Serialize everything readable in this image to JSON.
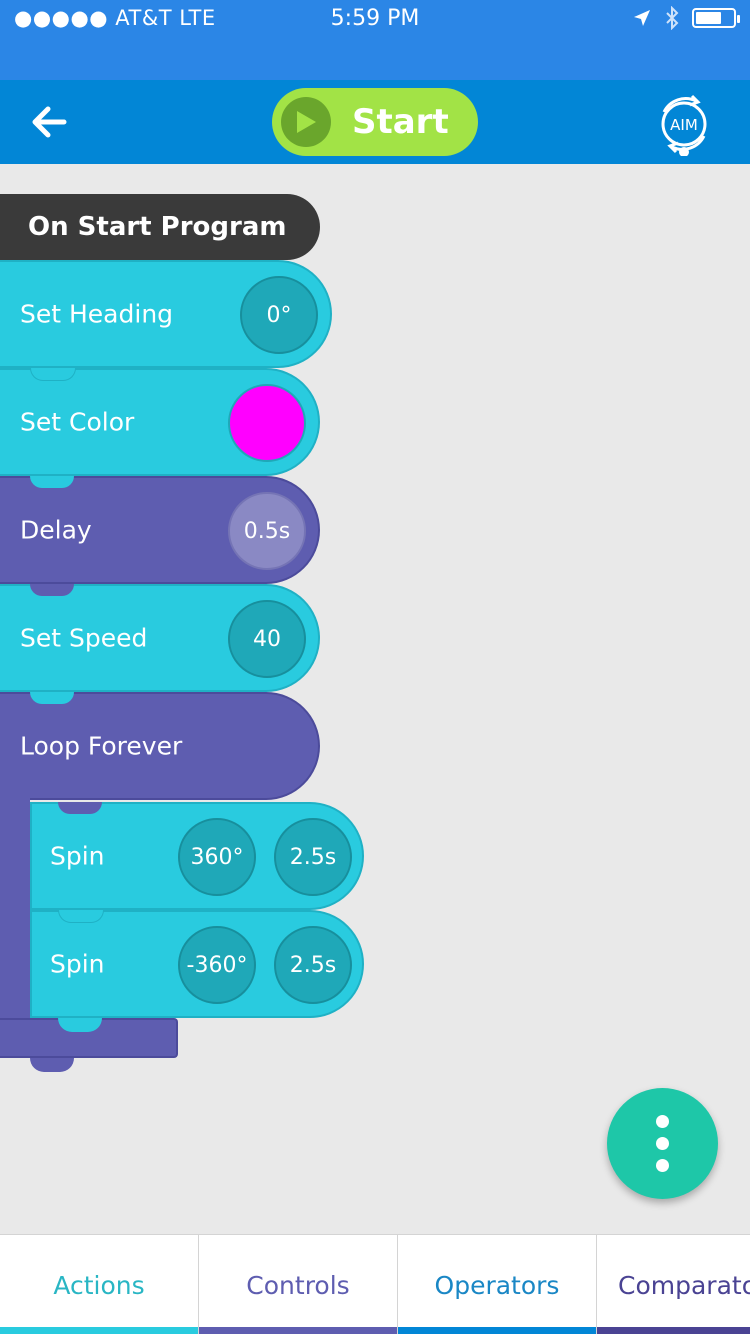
{
  "status_bar": {
    "carrier": "●●●●● AT&T   LTE",
    "time": "5:59 PM",
    "battery_level": 0.7
  },
  "nav": {
    "back_icon": "arrow-left-icon",
    "start_label": "Start",
    "start_icon": "play-icon",
    "aim_label": "AIM"
  },
  "program": {
    "title": "On Start Program",
    "blocks": {
      "set_heading": {
        "label": "Set Heading",
        "value": "0°"
      },
      "set_color": {
        "label": "Set Color",
        "color": "#ff00ff"
      },
      "delay": {
        "label": "Delay",
        "value": "0.5s"
      },
      "set_speed": {
        "label": "Set Speed",
        "value": "40"
      },
      "loop": {
        "label": "Loop Forever"
      },
      "spin1": {
        "label": "Spin",
        "angle": "360°",
        "duration": "2.5s"
      },
      "spin2": {
        "label": "Spin",
        "angle": "-360°",
        "duration": "2.5s"
      }
    }
  },
  "fab_icon": "more-vertical-icon",
  "tabs": {
    "actions": "Actions",
    "controls": "Controls",
    "operators": "Operators",
    "comparators": "Comparators"
  },
  "colors": {
    "action_block": "#29cbdf",
    "control_block": "#5e5db0",
    "start_block": "#3a3a3a",
    "nav_bar": "#0286d6",
    "start_button": "#a2e346",
    "fab": "#1ec7a8"
  }
}
